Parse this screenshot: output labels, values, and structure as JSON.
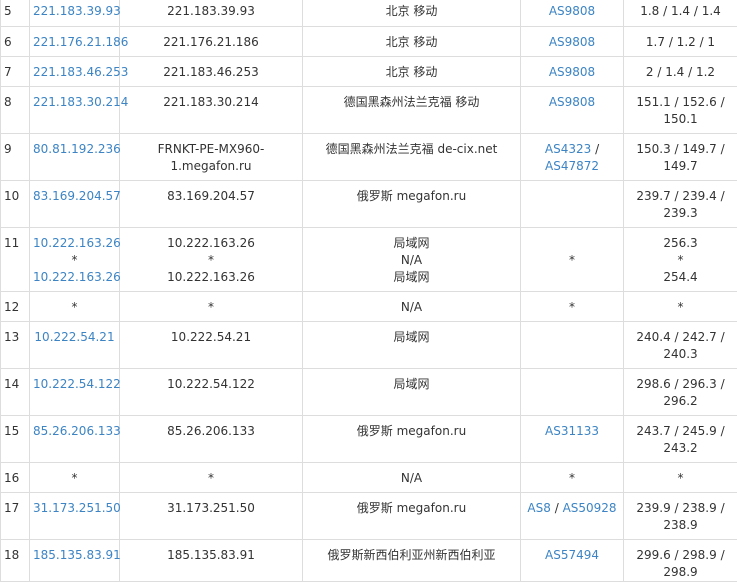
{
  "rows": [
    {
      "hop": "5",
      "ip_link": [
        "221.183.39.93"
      ],
      "host": [
        "221.183.39.93"
      ],
      "geo": [
        "北京 移动"
      ],
      "asn": [
        "AS9808"
      ],
      "latency": [
        "1.8 / 1.4 / 1.4"
      ]
    },
    {
      "hop": "6",
      "ip_link": [
        "221.176.21.186"
      ],
      "host": [
        "221.176.21.186"
      ],
      "geo": [
        "北京 移动"
      ],
      "asn": [
        "AS9808"
      ],
      "latency": [
        "1.7 / 1.2 / 1"
      ]
    },
    {
      "hop": "7",
      "ip_link": [
        "221.183.46.253"
      ],
      "host": [
        "221.183.46.253"
      ],
      "geo": [
        "北京 移动"
      ],
      "asn": [
        "AS9808"
      ],
      "latency": [
        "2 / 1.4 / 1.2"
      ]
    },
    {
      "hop": "8",
      "ip_link": [
        "221.183.30.214"
      ],
      "host": [
        "221.183.30.214"
      ],
      "geo": [
        "德国黑森州法兰克福 移动"
      ],
      "asn": [
        "AS9808"
      ],
      "latency": [
        "151.1 / 152.6 /",
        "150.1"
      ]
    },
    {
      "hop": "9",
      "ip_link": [
        "80.81.192.236"
      ],
      "host": [
        "FRNKT-PE-MX960-",
        "1.megafon.ru"
      ],
      "geo": [
        "德国黑森州法兰克福 de-cix.net"
      ],
      "asn": [
        "AS4323",
        "AS47872"
      ],
      "asn_sep": " /",
      "latency": [
        "150.3 / 149.7 /",
        "149.7"
      ]
    },
    {
      "hop": "10",
      "ip_link": [
        "83.169.204.57"
      ],
      "host": [
        "83.169.204.57"
      ],
      "geo": [
        "俄罗斯 megafon.ru"
      ],
      "asn": [],
      "latency": [
        "239.7 / 239.4 /",
        "239.3"
      ]
    },
    {
      "hop": "11",
      "ip_link": [
        "10.222.163.26",
        "*",
        "10.222.163.26"
      ],
      "host": [
        "10.222.163.26",
        "*",
        "10.222.163.26"
      ],
      "geo": [
        "局域网",
        "N/A",
        "局域网"
      ],
      "asn": [],
      "asn_plain": "*",
      "latency": [
        "256.3",
        "*",
        "254.4"
      ]
    },
    {
      "hop": "12",
      "ip_plain": "*",
      "host": [
        "*"
      ],
      "geo": [
        "N/A"
      ],
      "asn": [],
      "asn_plain": "*",
      "latency": [
        "*"
      ]
    },
    {
      "hop": "13",
      "ip_link": [
        "10.222.54.21"
      ],
      "host": [
        "10.222.54.21"
      ],
      "geo": [
        "局域网"
      ],
      "asn": [],
      "latency": [
        "240.4 / 242.7 /",
        "240.3"
      ]
    },
    {
      "hop": "14",
      "ip_link": [
        "10.222.54.122"
      ],
      "host": [
        "10.222.54.122"
      ],
      "geo": [
        "局域网"
      ],
      "asn": [],
      "latency": [
        "298.6 / 296.3 /",
        "296.2"
      ]
    },
    {
      "hop": "15",
      "ip_link": [
        "85.26.206.133"
      ],
      "host": [
        "85.26.206.133"
      ],
      "geo": [
        "俄罗斯 megafon.ru"
      ],
      "asn": [
        "AS31133"
      ],
      "latency": [
        "243.7 / 245.9 /",
        "243.2"
      ]
    },
    {
      "hop": "16",
      "ip_plain": "*",
      "host": [
        "*"
      ],
      "geo": [
        "N/A"
      ],
      "asn": [],
      "asn_plain": "*",
      "latency": [
        "*"
      ]
    },
    {
      "hop": "17",
      "ip_link": [
        "31.173.251.50"
      ],
      "host": [
        "31.173.251.50"
      ],
      "geo": [
        "俄罗斯 megafon.ru"
      ],
      "asn": [
        "AS8",
        "AS50928"
      ],
      "asn_sep": " / ",
      "asn_inline": true,
      "latency": [
        "239.9 / 238.9 /",
        "238.9"
      ]
    },
    {
      "hop": "18",
      "ip_link": [
        "185.135.83.91"
      ],
      "host": [
        "185.135.83.91"
      ],
      "geo": [
        "俄罗斯新西伯利亚州新西伯利亚"
      ],
      "asn": [
        "AS57494"
      ],
      "latency": [
        "299.6 / 298.9 /",
        "298.9"
      ]
    }
  ]
}
